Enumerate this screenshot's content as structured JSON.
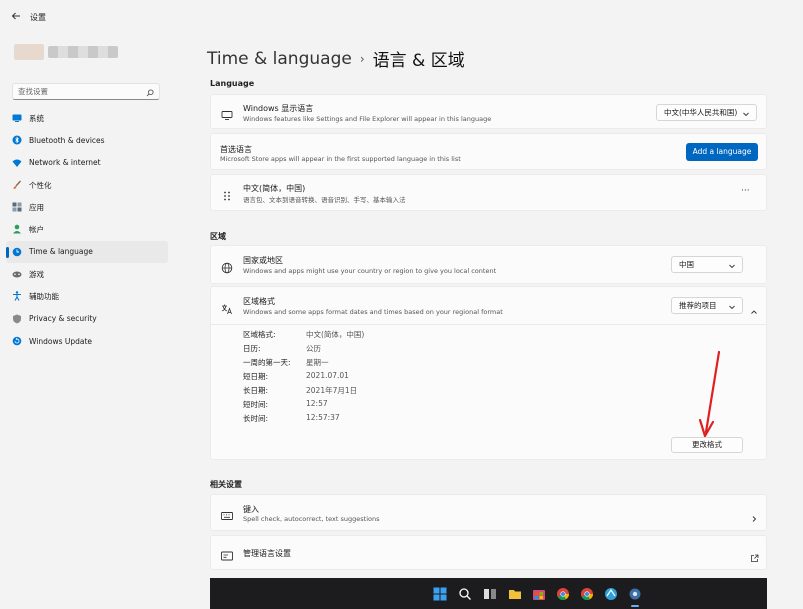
{
  "window": {
    "title": "设置"
  },
  "sidebar": {
    "search_placeholder": "查找设置",
    "items": [
      {
        "label": "系统",
        "icon": "monitor-icon",
        "color": "#0078d4"
      },
      {
        "label": "Bluetooth & devices",
        "icon": "bluetooth-icon",
        "color": "#0078d4"
      },
      {
        "label": "Network & internet",
        "icon": "wifi-icon",
        "color": "#0078d4"
      },
      {
        "label": "个性化",
        "icon": "brush-icon",
        "color": "#e07030"
      },
      {
        "label": "应用",
        "icon": "apps-icon",
        "color": "#5a6b7b"
      },
      {
        "label": "帐户",
        "icon": "person-icon",
        "color": "#2d9c5f"
      },
      {
        "label": "Time & language",
        "icon": "globe-clock-icon",
        "color": "#0078d4",
        "active": true
      },
      {
        "label": "游戏",
        "icon": "gamepad-icon",
        "color": "#6b6b6b"
      },
      {
        "label": "辅助功能",
        "icon": "accessibility-icon",
        "color": "#0078d4"
      },
      {
        "label": "Privacy & security",
        "icon": "shield-icon",
        "color": "#6b6b6b"
      },
      {
        "label": "Windows Update",
        "icon": "update-icon",
        "color": "#0078d4"
      }
    ]
  },
  "header": {
    "parent": "Time & language",
    "separator": "›",
    "current": "语言 & 区域"
  },
  "language": {
    "section_title": "Language",
    "display": {
      "title": "Windows 显示语言",
      "subtitle": "Windows features like Settings and File Explorer will appear in this language",
      "value": "中文(中华人民共和国)"
    },
    "preferred": {
      "title": "首选语言",
      "subtitle": "Microsoft Store apps will appear in the first supported language in this list",
      "button": "Add a language"
    },
    "entry": {
      "title": "中文(简体，中国)",
      "subtitle": "语言包、文本到语音转换、语音识别、手写、基本输入法",
      "more": "···"
    }
  },
  "region": {
    "section_title": "区域",
    "country": {
      "title": "国家或地区",
      "subtitle": "Windows and apps might use your country or region to give you local content",
      "value": "中国"
    },
    "format": {
      "title": "区域格式",
      "subtitle": "Windows and some apps format dates and times based on your regional format",
      "value": "推荐的项目",
      "details": [
        {
          "label": "区域格式:",
          "value": "中文(简体，中国)"
        },
        {
          "label": "日历:",
          "value": "公历"
        },
        {
          "label": "一周的第一天:",
          "value": "星期一"
        },
        {
          "label": "短日期:",
          "value": "2021.07.01"
        },
        {
          "label": "长日期:",
          "value": "2021年7月1日"
        },
        {
          "label": "短时间:",
          "value": "12:57"
        },
        {
          "label": "长时间:",
          "value": "12:57:37"
        }
      ],
      "change_button": "更改格式"
    }
  },
  "related": {
    "section_title": "相关设置",
    "keyboard": {
      "title": "键入",
      "subtitle": "Spell check, autocorrect, text suggestions"
    },
    "admin": {
      "title": "管理语言设置"
    }
  },
  "colors": {
    "accent": "#0067c0",
    "annotation_arrow": "#e02020"
  }
}
